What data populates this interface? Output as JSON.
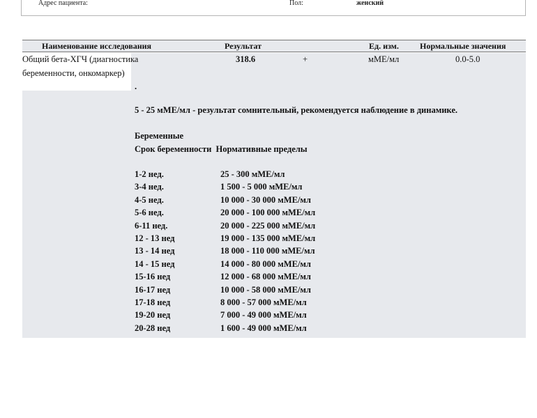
{
  "patient": {
    "address_label": "Адрес пациента:",
    "sex_label": "Пол:",
    "sex_value": "женский"
  },
  "table": {
    "headers": [
      "Наименование исследования",
      "Результат",
      "Ед. изм.",
      "Нормальные значения"
    ],
    "row": {
      "name_line1": "Общий бета-ХГЧ (диагностика",
      "name_line2": "беременности, онкомаркер)",
      "result": "318.6",
      "flag": "+",
      "unit": "мМЕ/мл",
      "normal": "0.0-5.0"
    }
  },
  "notes": {
    "dot": ".",
    "doubtful": "5 - 25 мМЕ/мл - результат сомнительный, рекомендуется наблюдение в динамике.",
    "pregnant_title": "Беременные",
    "col_term": "Срок беременности",
    "col_limits": "Нормативные пределы"
  },
  "ranges": [
    {
      "term": "1-2 нед.",
      "value": "25 - 300 мМЕ/мл"
    },
    {
      "term": "3-4 нед.",
      "value": "1 500 - 5 000 мМЕ/мл"
    },
    {
      "term": "4-5 нед.",
      "value": "10 000 - 30 000 мМЕ/мл"
    },
    {
      "term": "5-6 нед.",
      "value": "20 000 - 100 000 мМЕ/мл"
    },
    {
      "term": "6-11 нед.",
      "value": "20 000 - 225 000 мМЕ/мл"
    },
    {
      "term": "12 - 13 нед",
      "value": "19 000 - 135 000 мМЕ/мл"
    },
    {
      "term": "13 - 14 нед",
      "value": "18 000 - 110 000 мМЕ/мл"
    },
    {
      "term": "14 - 15 нед",
      "value": "14 000 - 80 000 мМЕ/мл"
    },
    {
      "term": "15-16 нед",
      "value": "12 000 - 68 000 мМЕ/мл"
    },
    {
      "term": "16-17 нед",
      "value": "10 000 - 58 000 мМЕ/мл"
    },
    {
      "term": "17-18 нед",
      "value": "8 000 - 57 000 мМЕ/мл"
    },
    {
      "term": "19-20 нед",
      "value": "7 000 - 49 000 мМЕ/мл"
    },
    {
      "term": "20-28 нед",
      "value": "1 600 - 49 000 мМЕ/мл"
    }
  ]
}
